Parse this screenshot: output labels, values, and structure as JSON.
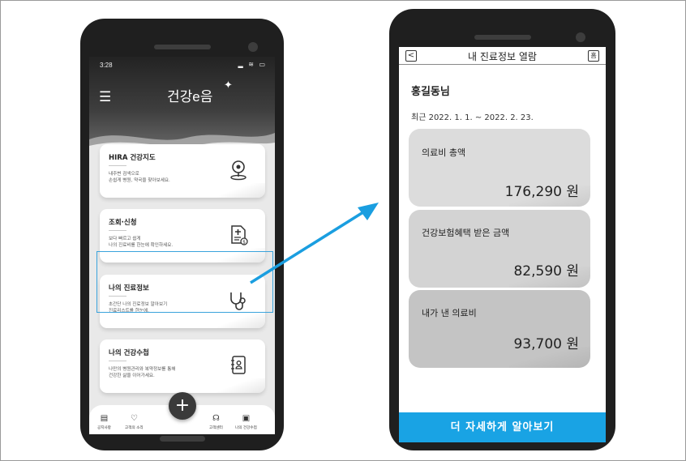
{
  "left_phone": {
    "status_time": "3:28",
    "status_icons": "▂ ≋ ▭",
    "brand": "건강e음",
    "cards": [
      {
        "title": "HIRA 건강지도",
        "desc_line1": "내주변 검색으로",
        "desc_line2": "손쉽게 병원, 약국을 찾아보세요.",
        "icon": "map-pin-icon"
      },
      {
        "title": "조회·신청",
        "desc_line1": "보다 빠르고 쉽게",
        "desc_line2": "나의 진료비를 한눈에 확인하세요.",
        "icon": "document-money-icon"
      },
      {
        "title": "나의 진료정보",
        "desc_line1": "초간단 나의 진료정보 알아보기",
        "desc_line2": "진료리스트를 한눈에.",
        "icon": "stethoscope-icon"
      },
      {
        "title": "나의 건강수첩",
        "desc_line1": "나만의 병원관리와 복약정보를 통해",
        "desc_line2": "건강한 삶을 이어가세요.",
        "icon": "notebook-icon"
      }
    ],
    "nav": [
      {
        "label": "공지사항",
        "icon": "notice-icon"
      },
      {
        "label": "고객의 소리",
        "icon": "heart-chat-icon"
      },
      {
        "label": "고객센터",
        "icon": "headset-icon"
      },
      {
        "label": "나의 건강수첩",
        "icon": "notebook-icon"
      }
    ],
    "fab_label": "+"
  },
  "right_phone": {
    "header": {
      "back": "<",
      "title": "내 진료정보 열람",
      "home": "홈"
    },
    "user_name": "홍길동님",
    "period": "최근 2022. 1. 1. ~ 2022. 2. 23.",
    "amounts": [
      {
        "label": "의료비 총액",
        "value": "176,290 원",
        "color": "#dcdcdc"
      },
      {
        "label": "건강보험혜택 받은 금액",
        "value": "82,590 원",
        "color": "#d3d3d3"
      },
      {
        "label": "내가 낸 의료비",
        "value": "93,700 원",
        "color": "#c4c4c4"
      }
    ],
    "cta": "더 자세하게 알아보기"
  },
  "colors": {
    "accent": "#19a3e4",
    "highlight_border": "#3aa3dc",
    "phone": "#1f1f1f"
  }
}
